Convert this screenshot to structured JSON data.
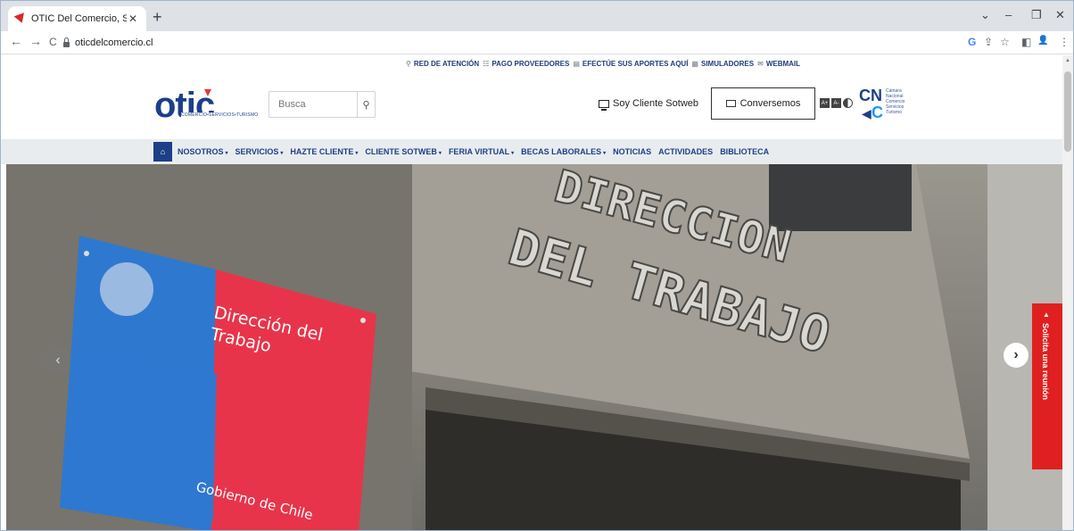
{
  "browser": {
    "tab_title": "OTIC Del Comercio, Servicios y T...",
    "tab_close": "✕",
    "new_tab": "+",
    "url": "oticdelcomercio.cl",
    "window_controls": {
      "chevron": "⌄",
      "minimize": "–",
      "restore": "❐",
      "close": "✕"
    },
    "nav": {
      "back": "←",
      "forward": "→",
      "reload": "C"
    },
    "toolbar_icons": {
      "google": "G",
      "share": "⇪",
      "star": "☆",
      "sidepanel": "◧",
      "profile": "👤",
      "menu": "⋮"
    }
  },
  "utility_bar": {
    "links": [
      {
        "icon": "⚲",
        "label": "RED DE ATENCIÓN"
      },
      {
        "icon": "☷",
        "label": "PAGO PROVEEDORES"
      },
      {
        "icon": "▤",
        "label": "EFECTÚE SUS APORTES AQUÍ"
      },
      {
        "icon": "▦",
        "label": "SIMULADORES"
      },
      {
        "icon": "✉",
        "label": "WEBMAIL"
      }
    ]
  },
  "header": {
    "logo_text": "otic",
    "logo_tagline": "COMERCIO•SERVICIOS•TURISMO",
    "search_placeholder": "Busca",
    "search_icon": "⚲",
    "cliente_label": "Soy Cliente Sotweb",
    "conversemos_label": "Conversemos",
    "a11y": {
      "increase": "A+",
      "decrease": "A-"
    },
    "cnc": {
      "line1": "Cámara",
      "line2": "Nacional",
      "line3": "Comercio",
      "line4": "Servicios",
      "line5": "Turismo"
    }
  },
  "menu": {
    "home_icon": "⌂",
    "items": [
      {
        "label": "NOSOTROS",
        "dropdown": true
      },
      {
        "label": "SERVICIOS",
        "dropdown": true
      },
      {
        "label": "HAZTE CLIENTE",
        "dropdown": true
      },
      {
        "label": "CLIENTE SOTWEB",
        "dropdown": true
      },
      {
        "label": "FERIA VIRTUAL",
        "dropdown": true
      },
      {
        "label": "BECAS LABORALES",
        "dropdown": true
      },
      {
        "label": "NOTICIAS",
        "dropdown": false
      },
      {
        "label": "ACTIVIDADES",
        "dropdown": false
      },
      {
        "label": "BIBLIOTECA",
        "dropdown": false
      }
    ],
    "caret": "▾"
  },
  "hero": {
    "building_sign_line1": "DIRECCION",
    "building_sign_line2": "DEL TRABAJO",
    "plaque_line1": "Dirección del",
    "plaque_line2": "Trabajo",
    "plaque_footer": "Gobierno de Chile",
    "prev": "‹",
    "next": "›",
    "solicita_label": "Solicita una reunión",
    "solicita_arrow": "▲"
  }
}
